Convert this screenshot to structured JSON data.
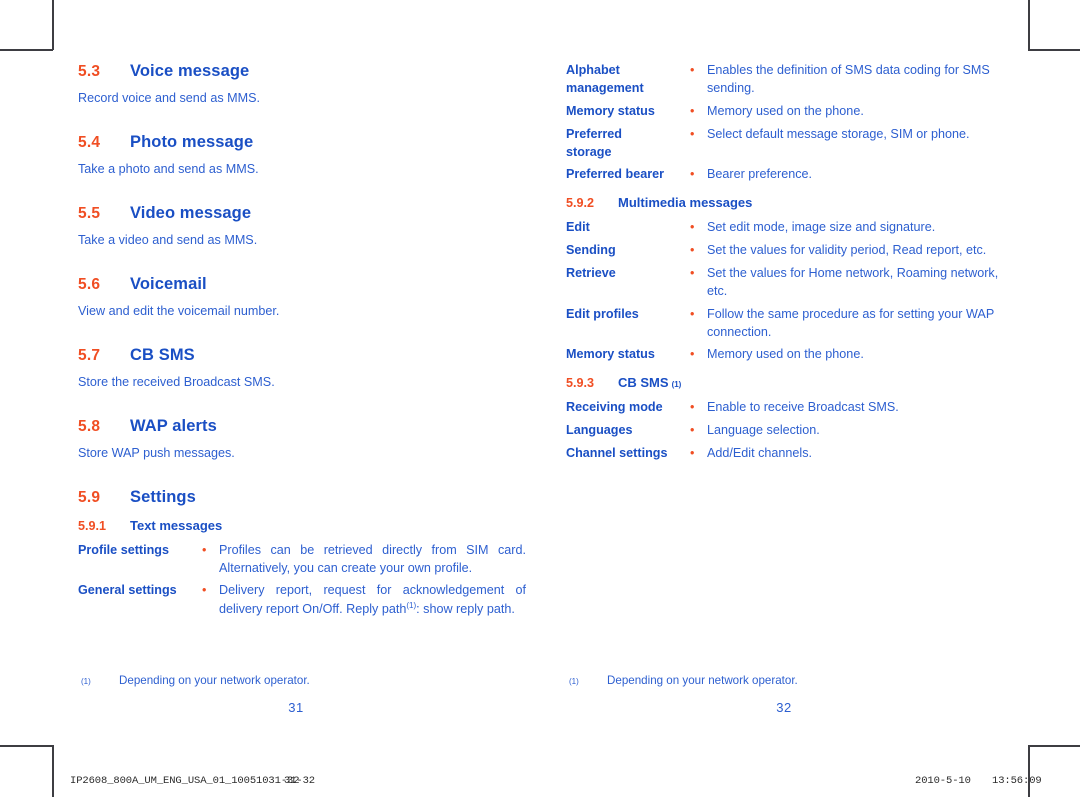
{
  "document": {
    "type": "user-manual-spread",
    "colors": {
      "accent_orange": "#f04e23",
      "heading_blue": "#1a4fc4",
      "body_blue": "#2d5fd0",
      "crop_mark": "#3d3d42",
      "page_background": "#ffffff"
    }
  },
  "left_page": {
    "folio": "31",
    "sections": [
      {
        "num": "5.3",
        "title": "Voice message",
        "desc": "Record voice and send as MMS."
      },
      {
        "num": "5.4",
        "title": "Photo message",
        "desc": "Take a photo and send as MMS."
      },
      {
        "num": "5.5",
        "title": "Video message",
        "desc": "Take a video and send as MMS."
      },
      {
        "num": "5.6",
        "title": "Voicemail",
        "desc": "View and edit the voicemail number."
      },
      {
        "num": "5.7",
        "title": "CB SMS",
        "desc": "Store the received Broadcast SMS."
      },
      {
        "num": "5.8",
        "title": "WAP alerts",
        "desc": "Store WAP push messages."
      },
      {
        "num": "5.9",
        "title": "Settings",
        "desc": ""
      }
    ],
    "subsection": {
      "num": "5.9.1",
      "title": "Text messages"
    },
    "rows": [
      {
        "term": "Profile settings",
        "bullet": "•",
        "desc": "Profiles can be retrieved directly from SIM card. Alternatively, you can create your own profile."
      },
      {
        "term": "General settings",
        "bullet": "•",
        "desc_a": "Delivery report, request for acknowledgement of delivery report On/Off. Reply path",
        "sup": "(1)",
        "desc_b": ": show reply path."
      }
    ],
    "footnote": {
      "mark": "(1)",
      "text": "Depending on your network operator."
    }
  },
  "right_page": {
    "folio": "32",
    "rows_top": [
      {
        "term_line1": "Alphabet",
        "term_line2": "management",
        "bullet": "•",
        "desc": "Enables the definition of SMS data coding for SMS sending."
      },
      {
        "term_line1": "Memory status",
        "term_line2": "",
        "bullet": "•",
        "desc": "Memory used on the phone."
      },
      {
        "term_line1": "Preferred",
        "term_line2": "storage",
        "bullet": "•",
        "desc": "Select default message storage, SIM or phone."
      },
      {
        "term_line1": "Preferred bearer",
        "term_line2": "",
        "bullet": "•",
        "desc": "Bearer preference."
      }
    ],
    "subsection_mm": {
      "num": "5.9.2",
      "title": "Multimedia messages"
    },
    "rows_mm": [
      {
        "term": "Edit",
        "bullet": "•",
        "desc": "Set edit mode, image size and signature."
      },
      {
        "term": "Sending",
        "bullet": "•",
        "desc": "Set the values for validity period, Read report, etc."
      },
      {
        "term": "Retrieve",
        "bullet": "•",
        "desc": "Set the values for Home network, Roaming network, etc."
      },
      {
        "term": "Edit profiles",
        "bullet": "•",
        "desc": "Follow the same procedure as for setting your WAP connection."
      },
      {
        "term": "Memory status",
        "bullet": "•",
        "desc": "Memory used on the phone."
      }
    ],
    "subsection_cb": {
      "num": "5.9.3",
      "title": "CB SMS",
      "sup": "(1)"
    },
    "rows_cb": [
      {
        "term": "Receiving mode",
        "bullet": "•",
        "desc": "Enable to receive Broadcast SMS."
      },
      {
        "term": "Languages",
        "bullet": "•",
        "desc": "Language selection."
      },
      {
        "term": "Channel settings",
        "bullet": "•",
        "desc": "Add/Edit channels."
      }
    ],
    "footnote": {
      "mark": "(1)",
      "text": "Depending on your network operator."
    }
  },
  "statusbar": {
    "filename": "IP2608_800A_UM_ENG_USA_01_10051031-32",
    "pages": "31-32",
    "date": "2010-5-10",
    "time": "13:56:09"
  }
}
